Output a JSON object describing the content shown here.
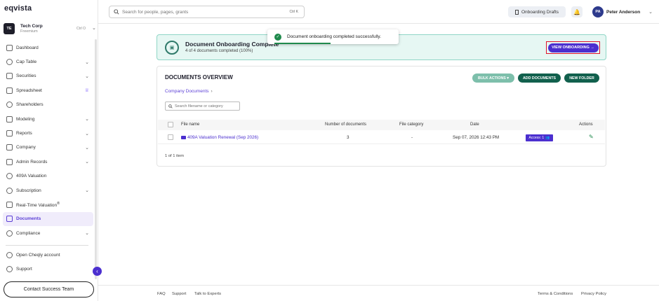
{
  "app": {
    "logo": "eqvista"
  },
  "org": {
    "initials": "TE",
    "name": "Tech Corp",
    "plan": "Freemium",
    "shortcut": "Ctrl O"
  },
  "sidebar": {
    "items": [
      {
        "label": "Dashboard",
        "chevron": false
      },
      {
        "label": "Cap Table",
        "chevron": true
      },
      {
        "label": "Securities",
        "chevron": true
      },
      {
        "label": "Spreadsheet",
        "crown": true
      },
      {
        "label": "Shareholders",
        "chevron": false
      },
      {
        "label": "Modeling",
        "chevron": true
      },
      {
        "label": "Reports",
        "chevron": true
      },
      {
        "label": "Company",
        "chevron": true
      },
      {
        "label": "Admin Records",
        "chevron": true
      },
      {
        "label": "409A Valuation",
        "chevron": false
      },
      {
        "label": "Subscription",
        "chevron": true
      },
      {
        "label": "Real-Time Valuation",
        "superscript": "®"
      },
      {
        "label": "Documents",
        "active": true
      },
      {
        "label": "Compliance",
        "chevron": true
      }
    ],
    "bottom_items": [
      {
        "label": "Open Cheqly account"
      },
      {
        "label": "Support"
      }
    ],
    "contact_button": "Contact Success Team"
  },
  "header": {
    "search_placeholder": "Search for people, pages, grants",
    "search_shortcut": "Ctrl K",
    "drafts_label": "Onboarding Drafts",
    "user_initials": "PA",
    "user_name": "Peter Anderson"
  },
  "toast": {
    "message": "Document onboarding completed successfully."
  },
  "banner": {
    "title": "Document Onboarding Complete",
    "subtitle": "4 of 4 documents completed (100%)",
    "button": "VIEW ONBOARDING →"
  },
  "documents": {
    "title": "DOCUMENTS OVERVIEW",
    "bulk_actions": "BULK ACTIONS ▾",
    "add_documents": "ADD DOCUMENTS",
    "new_folder": "NEW FOLDER",
    "breadcrumb": "Company Documents",
    "filter_placeholder": "Search filename or category",
    "columns": [
      "File name",
      "Number of documents",
      "File category",
      "Date",
      "Actions"
    ],
    "rows": [
      {
        "file_name": "409A Valuation Renewal (Sep 2026)",
        "count": "3",
        "category": "-",
        "date": "Sep 07, 2026 12:43 PM",
        "access": "Access: 1"
      }
    ],
    "item_count": "1 of 1 item"
  },
  "footer": {
    "links_left": [
      "FAQ",
      "Support",
      "Talk to Experts"
    ],
    "links_right": [
      "Terms & Conditions",
      "Privacy Policy"
    ]
  },
  "colors": {
    "primary": "#4b2fcf",
    "teal": "#11604d",
    "banner_bg": "#e6f7f3",
    "highlight": "#e0112b"
  }
}
